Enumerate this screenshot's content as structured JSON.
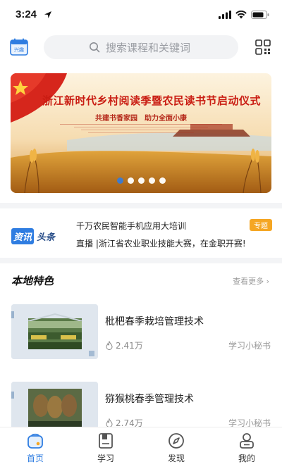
{
  "status": {
    "time": "3:24"
  },
  "header": {
    "calendar_label": "兴趣",
    "search_placeholder": "搜索课程和关键词"
  },
  "banner": {
    "title": "浙江新时代乡村阅读季暨农民读书节启动仪式",
    "subtitle": "共建书香家园　助力全面小康",
    "slides": 5,
    "active_slide": 0
  },
  "news": {
    "logo_part1": "资讯",
    "logo_part2": "头条",
    "line1": "千万农民智能手机应用大培训",
    "line2": "直播 |浙江省农业职业技能大赛，在金职开赛!",
    "tag": "专题"
  },
  "local": {
    "title": "本地特色",
    "more": "查看更多 ›",
    "courses": [
      {
        "title": "枇杷春季栽培管理技术",
        "views": "2.41万",
        "author": "学习小秘书"
      },
      {
        "title": "猕猴桃春季管理技术",
        "views": "2.74万",
        "author": "学习小秘书"
      }
    ]
  },
  "tabbar": {
    "tabs": [
      {
        "label": "首页",
        "icon": "home-icon",
        "active": true
      },
      {
        "label": "学习",
        "icon": "book-icon",
        "active": false
      },
      {
        "label": "发现",
        "icon": "compass-icon",
        "active": false
      },
      {
        "label": "我的",
        "icon": "user-icon",
        "active": false
      }
    ]
  },
  "colors": {
    "accent": "#2f7de1",
    "tag": "#f5a623",
    "banner_red": "#c91c12"
  }
}
